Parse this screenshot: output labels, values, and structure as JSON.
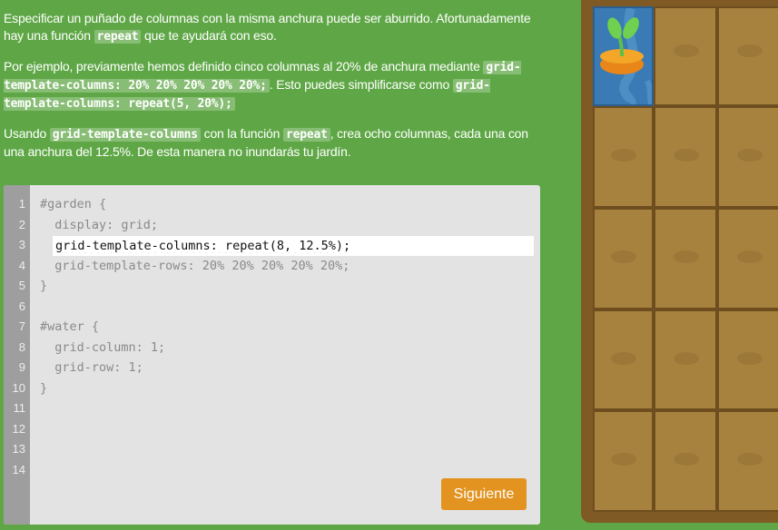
{
  "instructions": {
    "p1_a": "Especificar un puñado de columnas con la misma anchura puede ser aburrido. Afortunadamente hay una función",
    "p1_code": "repeat",
    "p1_b": "que te ayudará con eso.",
    "p2_a": "Por ejemplo, previamente hemos definido cinco columnas al 20% de anchura mediante",
    "p2_code1": "grid-template-columns: 20% 20% 20% 20% 20%;",
    "p2_b": ". Esto puedes simplificarse como",
    "p2_code2": "grid-template-columns: repeat(5, 20%);",
    "p3_a": "Usando",
    "p3_code1": "grid-template-columns",
    "p3_b": "con la función",
    "p3_code2": "repeat",
    "p3_c": ", crea ocho columnas, cada una con una anchura del 12.5%. De esta manera no inundarás tu jardín."
  },
  "editor": {
    "line_numbers": [
      "1",
      "2",
      "3",
      "4",
      "5",
      "6",
      "7",
      "8",
      "9",
      "10",
      "11",
      "12",
      "13",
      "14"
    ],
    "line1": "#garden {",
    "line2": "  display: grid;",
    "input_value": "grid-template-columns: repeat(8, 12.5%);",
    "line4": "  grid-template-rows: 20% 20% 20% 20% 20%;",
    "line5": "}",
    "line7": "#water {",
    "line8": "  grid-column: 1;",
    "line9": "  grid-row: 1;",
    "line10": "}",
    "next_label": "Siguiente"
  },
  "colors": {
    "background": "#5fa746",
    "button": "#e29320",
    "soil": "#a7823f",
    "water": "#3a7ab5"
  },
  "garden": {
    "icons": [
      "carrot-sprout-icon"
    ]
  }
}
